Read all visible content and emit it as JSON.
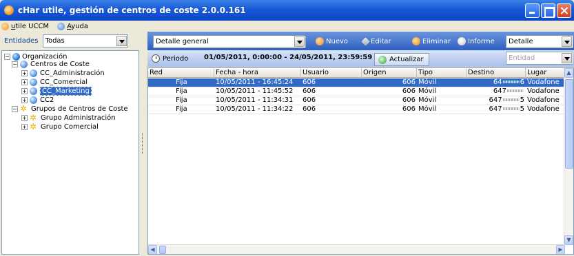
{
  "window": {
    "title": "cHar utile, gestión de centros de coste 2.0.0.161"
  },
  "menu": {
    "items": [
      {
        "label": "utile UCCM",
        "icon": "orange-orb-icon"
      },
      {
        "label": "Ayuda",
        "icon": "help-icon"
      }
    ]
  },
  "left_toolbar": {
    "label": "Entidades",
    "filter_value": "Todas"
  },
  "tree": {
    "root": "Organización",
    "group1": "Centros de Coste",
    "cc": [
      "CC_Administración",
      "CC_Comercial",
      "CC_Marketing",
      "CC2"
    ],
    "group2": "Grupos de Centros de Coste",
    "groups": [
      "Grupo Administración",
      "Grupo Comercial"
    ],
    "selected": "CC_Marketing"
  },
  "toolbar": {
    "view_select": "Detalle general",
    "new_label": "Nuevo",
    "edit_label": "Editar",
    "delete_label": "Eliminar",
    "report_label": "Informe",
    "detail_select": "Detalle",
    "entity_placeholder": "Entidad"
  },
  "period": {
    "label": "Periodo",
    "range": "01/05/2011, 0:00:00 - 24/05/2011, 23:59:59",
    "refresh_label": "Actualizar"
  },
  "grid": {
    "columns": [
      "Red",
      "Fecha - hora",
      "Usuario",
      "Origen",
      "Tipo",
      "Destino",
      "Lugar"
    ],
    "rows": [
      {
        "red": "Fija",
        "fecha": "10/05/2011 - 16:45:24",
        "usuario": "606",
        "origen": "606",
        "tipo": "Móvil",
        "destino_a": "64",
        "destino_b": "6",
        "lugar": "Vodafone"
      },
      {
        "red": "Fija",
        "fecha": "10/05/2011 - 11:45:52",
        "usuario": "606",
        "origen": "606",
        "tipo": "Móvil",
        "destino_a": "647",
        "destino_b": "",
        "lugar": "Vodafone"
      },
      {
        "red": "Fija",
        "fecha": "10/05/2011 - 11:34:31",
        "usuario": "606",
        "origen": "606",
        "tipo": "Móvil",
        "destino_a": "647",
        "destino_b": "5",
        "lugar": "Vodafone"
      },
      {
        "red": "Fija",
        "fecha": "10/05/2011 - 11:34:22",
        "usuario": "606",
        "origen": "606",
        "tipo": "Móvil",
        "destino_a": "647",
        "destino_b": "5",
        "lugar": "Vodafone"
      }
    ],
    "selected_row": 0
  },
  "colors": {
    "title_bar": "#0a47c9",
    "toolbar": "#2e5fc1",
    "selection": "#316ac5",
    "period_bar": "#a9c0ea"
  }
}
